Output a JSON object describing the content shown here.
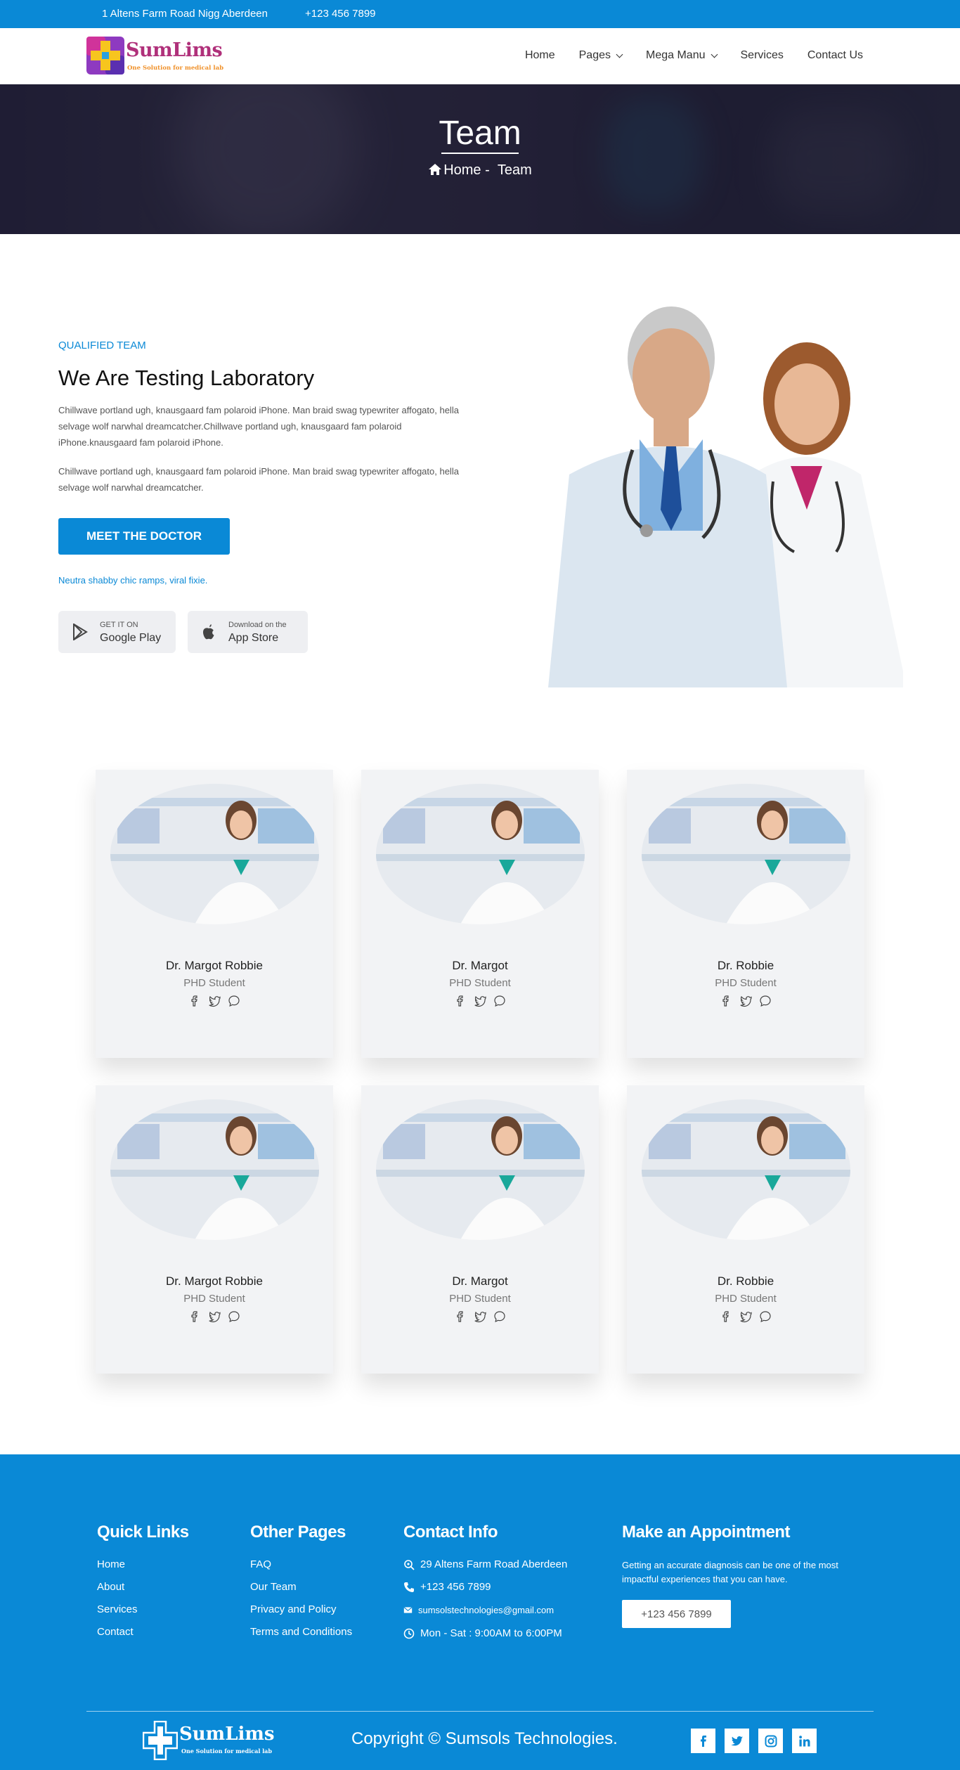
{
  "topbar": {
    "address": "1 Altens Farm Road Nigg Aberdeen",
    "phone": "+123 456 7899"
  },
  "brand": {
    "name": "SumLims",
    "tagline": "One Solution for medical lab"
  },
  "nav": {
    "items": [
      {
        "label": "Home"
      },
      {
        "label": "Pages"
      },
      {
        "label": "Mega Manu"
      },
      {
        "label": "Services"
      },
      {
        "label": "Contact Us"
      }
    ]
  },
  "hero": {
    "title": "Team",
    "crumb_home": "Home -",
    "crumb_current": "Team"
  },
  "about": {
    "eyebrow": "QUALIFIED TEAM",
    "title": "We Are Testing Laboratory",
    "paragraph1": "Chillwave portland ugh, knausgaard fam polaroid iPhone. Man braid swag typewriter affogato, hella selvage wolf narwhal dreamcatcher.Chillwave portland ugh, knausgaard fam polaroid iPhone.knausgaard fam polaroid iPhone.",
    "paragraph2": "Chillwave portland ugh, knausgaard fam polaroid iPhone. Man braid swag typewriter affogato, hella selvage wolf narwhal dreamcatcher.",
    "button": "MEET THE DOCTOR",
    "small_link": "Neutra shabby chic ramps, viral fixie.",
    "google_play": {
      "line1": "GET IT ON",
      "line2": "Google Play"
    },
    "app_store": {
      "line1": "Download on the",
      "line2": "App Store"
    }
  },
  "team": [
    {
      "name": "Dr. Margot Robbie",
      "role": "PHD Student"
    },
    {
      "name": "Dr. Margot",
      "role": "PHD Student"
    },
    {
      "name": "Dr. Robbie",
      "role": "PHD Student"
    },
    {
      "name": "Dr. Margot Robbie",
      "role": "PHD Student"
    },
    {
      "name": "Dr. Margot",
      "role": "PHD Student"
    },
    {
      "name": "Dr. Robbie",
      "role": "PHD Student"
    }
  ],
  "footer": {
    "quick_links": {
      "title": "Quick Links",
      "items": [
        "Home",
        "About",
        "Services",
        "Contact"
      ]
    },
    "other_pages": {
      "title": "Other Pages",
      "items": [
        "FAQ",
        "Our Team",
        "Privacy and Policy",
        "Terms and Conditions"
      ]
    },
    "contact": {
      "title": "Contact Info",
      "address": "29 Altens Farm Road Aberdeen",
      "phone": "+123 456 7899",
      "email": "sumsolstechnologies@gmail.com",
      "hours": "Mon - Sat : 9:00AM to 6:00PM"
    },
    "appointment": {
      "title": "Make an Appointment",
      "text": "Getting an accurate diagnosis can be one of the most impactful experiences that you can have.",
      "button": "+123 456 7899"
    },
    "copyright": "Copyright © Sumsols Technologies.",
    "social": [
      "f",
      "t",
      "ig",
      "in"
    ]
  },
  "colors": {
    "primary": "#0a89d6",
    "brand_magenta": "#b0307a",
    "brand_orange": "#f0912a"
  }
}
